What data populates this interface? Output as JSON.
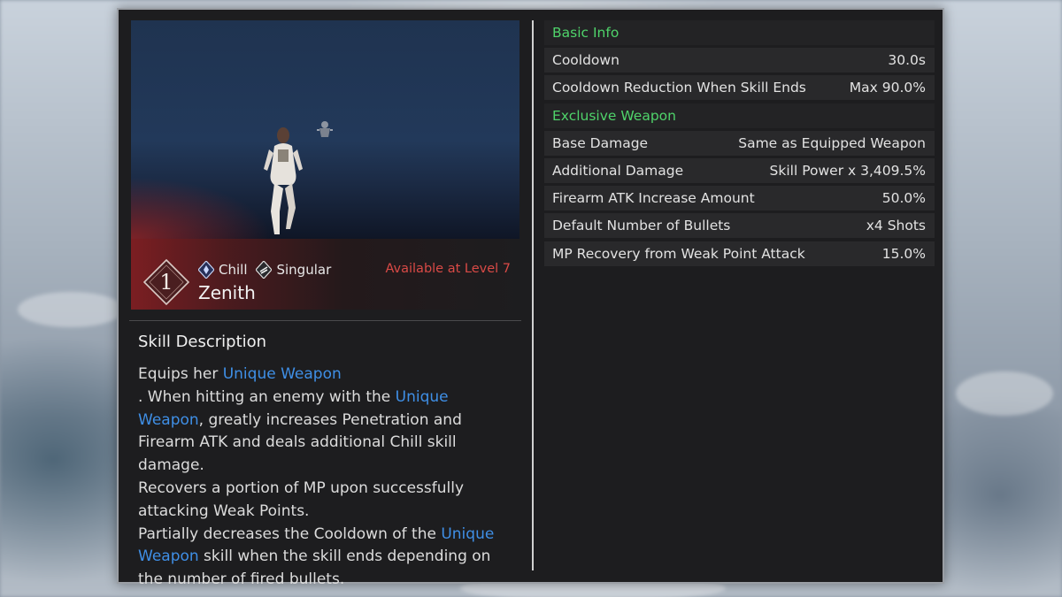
{
  "skill": {
    "rank": "1",
    "name": "Zenith",
    "tags": [
      {
        "label": "Chill",
        "icon": "chill-element-icon"
      },
      {
        "label": "Singular",
        "icon": "singular-type-icon"
      }
    ],
    "availability": "Available at Level 7"
  },
  "description": {
    "title": "Skill Description",
    "segments": [
      "Equips her ",
      "Unique Weapon",
      ". When hitting an enemy with the ",
      "Unique Weapon",
      ", greatly increases Penetration and Firearm ATK and deals additional Chill skill damage.",
      "Recovers a portion of MP upon successfully attacking Weak Points.",
      "Partially decreases the Cooldown of the ",
      "Unique Weapon",
      " skill when the skill ends depending on the number of fired bullets."
    ]
  },
  "info": {
    "basic_header": "Basic Info",
    "basic_rows": [
      {
        "label": "Cooldown",
        "value": "30.0s"
      },
      {
        "label": "Cooldown Reduction When Skill Ends",
        "value": "Max 90.0%"
      }
    ],
    "weapon_header": "Exclusive Weapon",
    "weapon_rows": [
      {
        "label": "Base Damage",
        "value": "Same as Equipped Weapon"
      },
      {
        "label": "Additional Damage",
        "value": "Skill Power x 3,409.5%"
      },
      {
        "label": "Firearm ATK Increase Amount",
        "value": "50.0%"
      },
      {
        "label": "Default Number of Bullets",
        "value": "x4 Shots"
      },
      {
        "label": "MP Recovery from Weak Point Attack",
        "value": "15.0%"
      }
    ]
  },
  "colors": {
    "panel_bg": "#1d1d1f",
    "header_green": "#4fd36a",
    "highlight_blue": "#3f8fe6",
    "availability_red": "#d94a46",
    "skill_band_red": "#801e22"
  }
}
